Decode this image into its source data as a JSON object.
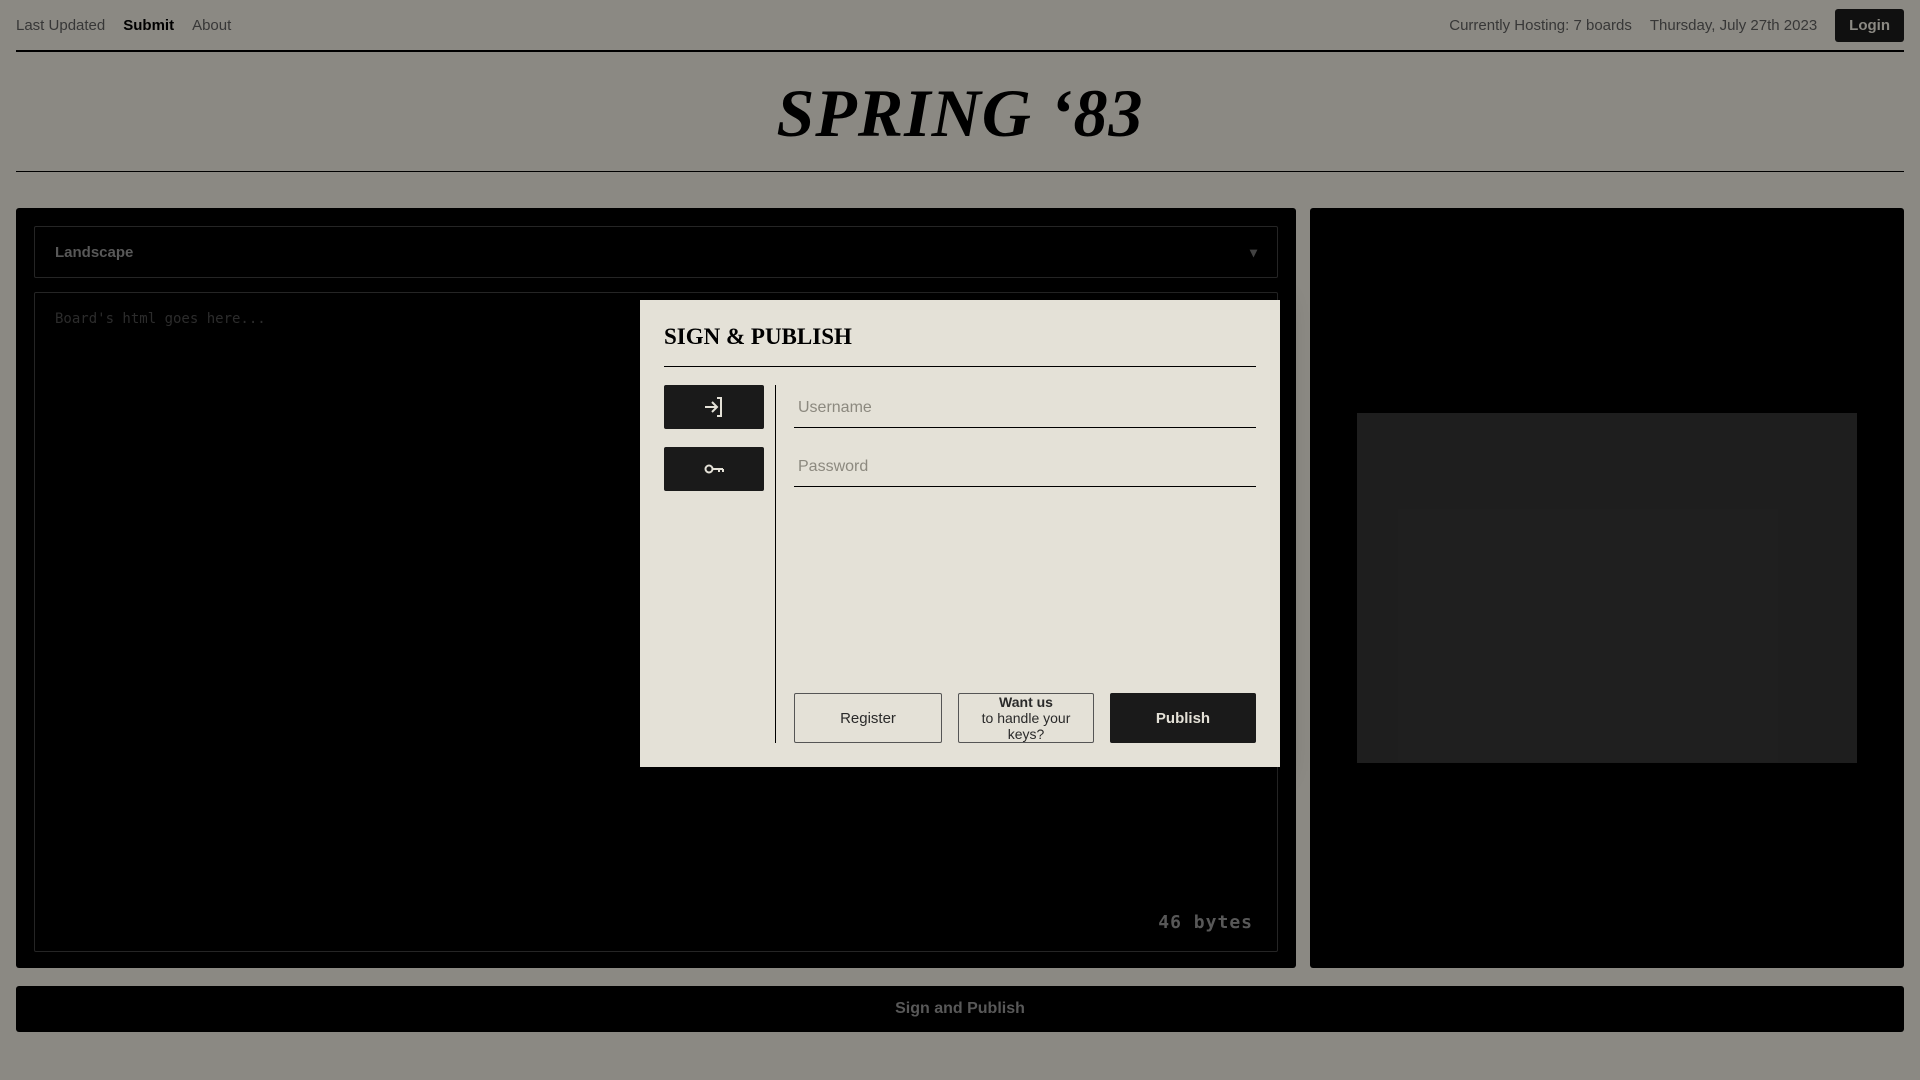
{
  "nav": {
    "last_updated": "Last Updated",
    "submit": "Submit",
    "about": "About",
    "hosting_status": "Currently Hosting: 7 boards",
    "date": "Thursday, July 27th 2023",
    "login": "Login"
  },
  "site": {
    "title": "SPRING ‘83"
  },
  "editor": {
    "layout_select": "Landscape",
    "placeholder": "Board's html goes here...",
    "byte_count": "46 bytes"
  },
  "footer": {
    "sign_publish": "Sign and Publish"
  },
  "modal": {
    "title": "SIGN & PUBLISH",
    "username_placeholder": "Username",
    "password_placeholder": "Password",
    "register": "Register",
    "handle_keys_strong": "Want us",
    "handle_keys_rest": " to handle your keys?",
    "publish": "Publish"
  }
}
